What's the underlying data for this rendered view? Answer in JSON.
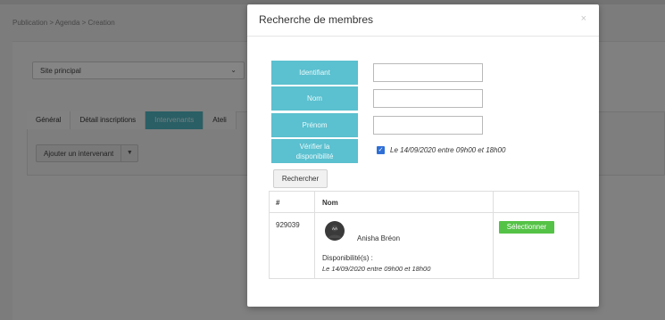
{
  "background": {
    "breadcrumb": "Publication > Agenda > Creation",
    "site_select": "Site principal",
    "tabs": [
      {
        "label": "Général",
        "active": false
      },
      {
        "label": "Détail inscriptions",
        "active": false
      },
      {
        "label": "Intervenants",
        "active": true
      },
      {
        "label": "Ateli",
        "active": false
      }
    ],
    "add_button": "Ajouter un intervenant"
  },
  "modal": {
    "title": "Recherche de membres",
    "close": "×",
    "fields": {
      "identifiant": {
        "label": "Identifiant",
        "value": ""
      },
      "nom": {
        "label": "Nom",
        "value": ""
      },
      "prenom": {
        "label": "Prénom",
        "value": ""
      }
    },
    "availability": {
      "label_line1": "Vérifier la",
      "label_line2": "disponibilité",
      "checked": true,
      "text": "Le 14/09/2020 entre 09h00 et 18h00"
    },
    "search_button": "Rechercher",
    "table": {
      "headers": [
        "#",
        "Nom",
        ""
      ],
      "rows": [
        {
          "id": "929039",
          "avatar_initials": "AA",
          "name": "Anisha Bréon",
          "dispo_label": "Disponibilité(s) :",
          "dispo_value": "Le 14/09/2020 entre 09h00 et 18h00",
          "action": "Sélectionner"
        }
      ]
    }
  },
  "colors": {
    "label_bg": "#5bc0cf",
    "select_btn": "#54c246",
    "active_tab": "#4fb6c2"
  }
}
